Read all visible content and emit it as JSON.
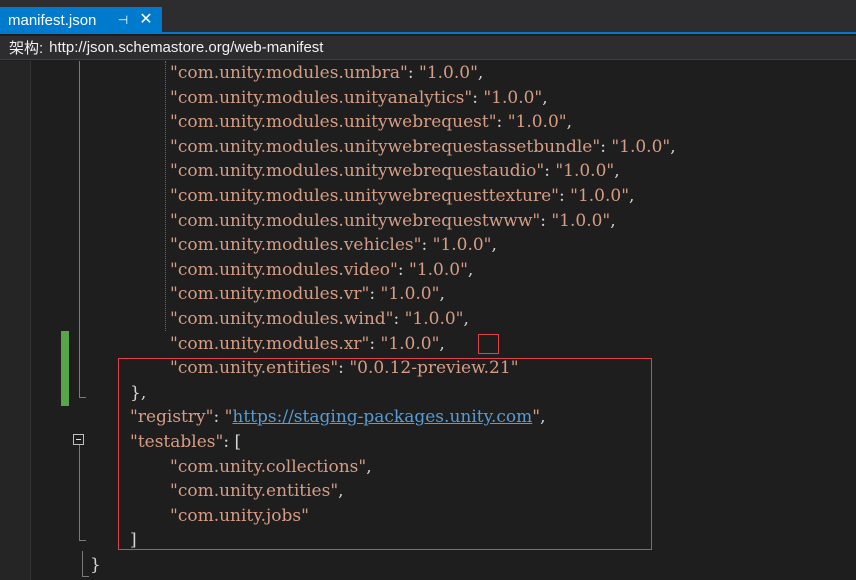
{
  "tab": {
    "title": "manifest.json",
    "pin_glyph": "⊣",
    "close_glyph": "✕",
    "pin_icon": "pin-icon",
    "close_icon": "close-icon"
  },
  "schema_bar": {
    "label": "架构:",
    "value": "http://json.schemastore.org/web-manifest"
  },
  "editor": {
    "lines": [
      {
        "indent": 2,
        "parts": [
          {
            "t": "\"com.unity.modules.umbra\"",
            "c": "key"
          },
          {
            "t": ": ",
            "c": "punc"
          },
          {
            "t": "\"1.0.0\"",
            "c": "str"
          },
          {
            "t": ",",
            "c": "punc"
          }
        ]
      },
      {
        "indent": 2,
        "parts": [
          {
            "t": "\"com.unity.modules.unityanalytics\"",
            "c": "key"
          },
          {
            "t": ": ",
            "c": "punc"
          },
          {
            "t": "\"1.0.0\"",
            "c": "str"
          },
          {
            "t": ",",
            "c": "punc"
          }
        ]
      },
      {
        "indent": 2,
        "parts": [
          {
            "t": "\"com.unity.modules.unitywebrequest\"",
            "c": "key"
          },
          {
            "t": ": ",
            "c": "punc"
          },
          {
            "t": "\"1.0.0\"",
            "c": "str"
          },
          {
            "t": ",",
            "c": "punc"
          }
        ]
      },
      {
        "indent": 2,
        "parts": [
          {
            "t": "\"com.unity.modules.unitywebrequestassetbundle\"",
            "c": "key"
          },
          {
            "t": ": ",
            "c": "punc"
          },
          {
            "t": "\"1.0.0\"",
            "c": "str"
          },
          {
            "t": ",",
            "c": "punc"
          }
        ]
      },
      {
        "indent": 2,
        "parts": [
          {
            "t": "\"com.unity.modules.unitywebrequestaudio\"",
            "c": "key"
          },
          {
            "t": ": ",
            "c": "punc"
          },
          {
            "t": "\"1.0.0\"",
            "c": "str"
          },
          {
            "t": ",",
            "c": "punc"
          }
        ]
      },
      {
        "indent": 2,
        "parts": [
          {
            "t": "\"com.unity.modules.unitywebrequesttexture\"",
            "c": "key"
          },
          {
            "t": ": ",
            "c": "punc"
          },
          {
            "t": "\"1.0.0\"",
            "c": "str"
          },
          {
            "t": ",",
            "c": "punc"
          }
        ]
      },
      {
        "indent": 2,
        "parts": [
          {
            "t": "\"com.unity.modules.unitywebrequestwww\"",
            "c": "key"
          },
          {
            "t": ": ",
            "c": "punc"
          },
          {
            "t": "\"1.0.0\"",
            "c": "str"
          },
          {
            "t": ",",
            "c": "punc"
          }
        ]
      },
      {
        "indent": 2,
        "parts": [
          {
            "t": "\"com.unity.modules.vehicles\"",
            "c": "key"
          },
          {
            "t": ": ",
            "c": "punc"
          },
          {
            "t": "\"1.0.0\"",
            "c": "str"
          },
          {
            "t": ",",
            "c": "punc"
          }
        ]
      },
      {
        "indent": 2,
        "parts": [
          {
            "t": "\"com.unity.modules.video\"",
            "c": "key"
          },
          {
            "t": ": ",
            "c": "punc"
          },
          {
            "t": "\"1.0.0\"",
            "c": "str"
          },
          {
            "t": ",",
            "c": "punc"
          }
        ]
      },
      {
        "indent": 2,
        "parts": [
          {
            "t": "\"com.unity.modules.vr\"",
            "c": "key"
          },
          {
            "t": ": ",
            "c": "punc"
          },
          {
            "t": "\"1.0.0\"",
            "c": "str"
          },
          {
            "t": ",",
            "c": "punc"
          }
        ]
      },
      {
        "indent": 2,
        "parts": [
          {
            "t": "\"com.unity.modules.wind\"",
            "c": "key"
          },
          {
            "t": ": ",
            "c": "punc"
          },
          {
            "t": "\"1.0.0\"",
            "c": "str"
          },
          {
            "t": ",",
            "c": "punc"
          }
        ]
      },
      {
        "indent": 2,
        "parts": [
          {
            "t": "\"com.unity.modules.xr\"",
            "c": "key"
          },
          {
            "t": ": ",
            "c": "punc"
          },
          {
            "t": "\"1.0.0\"",
            "c": "str"
          },
          {
            "t": ",",
            "c": "punc"
          }
        ]
      },
      {
        "indent": 2,
        "parts": [
          {
            "t": "\"com.unity.entities\"",
            "c": "key"
          },
          {
            "t": ": ",
            "c": "punc"
          },
          {
            "t": "\"0.0.12-preview.21\"",
            "c": "str"
          }
        ]
      },
      {
        "indent": 1,
        "parts": [
          {
            "t": "},",
            "c": "punc"
          }
        ]
      },
      {
        "indent": 1,
        "parts": [
          {
            "t": "\"registry\"",
            "c": "key"
          },
          {
            "t": ": ",
            "c": "punc"
          },
          {
            "t": "\"",
            "c": "str"
          },
          {
            "t": "https://staging-packages.unity.com",
            "c": "link"
          },
          {
            "t": "\"",
            "c": "str"
          },
          {
            "t": ",",
            "c": "punc"
          }
        ]
      },
      {
        "indent": 1,
        "parts": [
          {
            "t": "\"testables\"",
            "c": "key"
          },
          {
            "t": ": [",
            "c": "punc"
          }
        ]
      },
      {
        "indent": 2,
        "parts": [
          {
            "t": "\"com.unity.collections\"",
            "c": "str"
          },
          {
            "t": ",",
            "c": "punc"
          }
        ]
      },
      {
        "indent": 2,
        "parts": [
          {
            "t": "\"com.unity.entities\"",
            "c": "str"
          },
          {
            "t": ",",
            "c": "punc"
          }
        ]
      },
      {
        "indent": 2,
        "parts": [
          {
            "t": "\"com.unity.jobs\"",
            "c": "str"
          }
        ]
      },
      {
        "indent": 1,
        "parts": [
          {
            "t": "]",
            "c": "punc"
          }
        ]
      },
      {
        "indent": 0,
        "parts": [
          {
            "t": "}",
            "c": "punc"
          }
        ]
      }
    ]
  },
  "colors": {
    "accent": "#007acc",
    "string": "#d69d85",
    "link": "#569cd6",
    "change_bar": "#57a64a",
    "highlight_border": "#e0434a",
    "background": "#1e1e1e"
  },
  "outline_icon": "collapse-minus-icon"
}
